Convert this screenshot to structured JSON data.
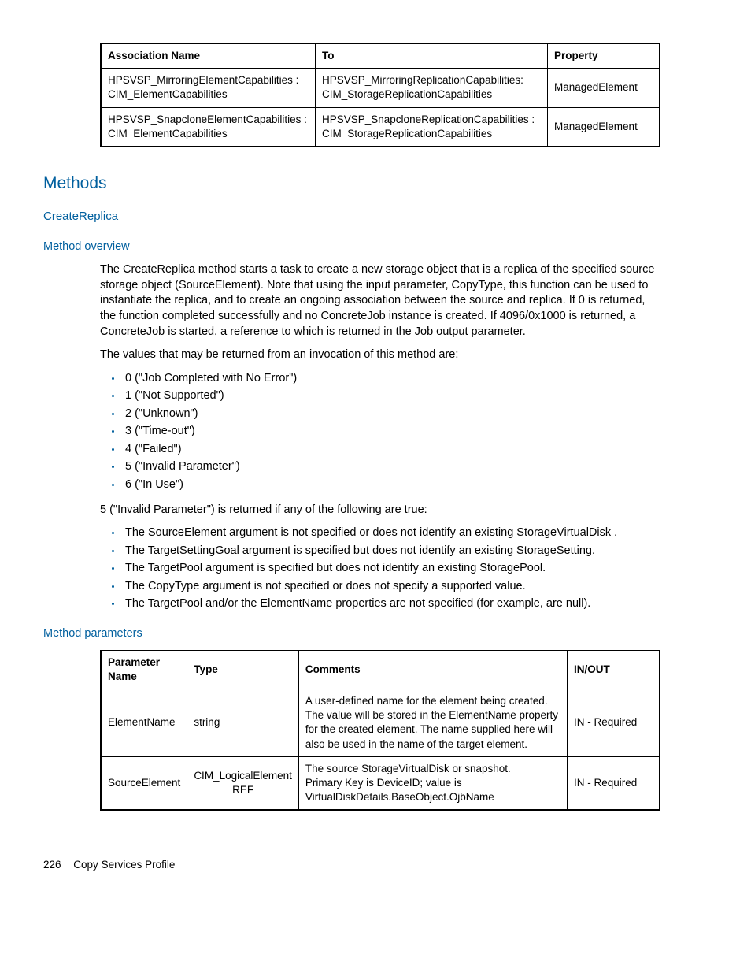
{
  "assocTable": {
    "headers": [
      "Association Name",
      "To",
      "Property"
    ],
    "rows": [
      [
        "HPSVSP_MirroringElementCapabilities : CIM_ElementCapabilities",
        "HPSVSP_MirroringReplicationCapabilities: CIM_StorageReplicationCapabilities",
        "ManagedElement"
      ],
      [
        "HPSVSP_SnapcloneElementCapabilities : CIM_ElementCapabilities",
        "HPSVSP_SnapcloneReplicationCapabilities : CIM_StorageReplicationCapabilities",
        "ManagedElement"
      ]
    ]
  },
  "methodsHeading": "Methods",
  "createReplicaHeading": "CreateReplica",
  "methodOverviewHeading": "Method overview",
  "overviewP1": "The CreateReplica method starts a task to create a new storage object that is a replica of the specified source storage object (SourceElement). Note that using the input parameter, CopyType, this function can be used to instantiate the replica, and to create an ongoing association between the source and replica. If 0 is returned, the function completed successfully and no ConcreteJob instance is created. If 4096/0x1000 is returned, a ConcreteJob is started, a reference to which is returned in the Job output parameter.",
  "overviewP2": "The values that may be returned from an invocation of this method are:",
  "returnValues": [
    "0 (\"Job Completed with No Error\")",
    "1 (\"Not Supported\")",
    "2 (\"Unknown\")",
    "3 (\"Time-out\")",
    "4 (\"Failed\")",
    "5 (\"Invalid Parameter\")",
    "6 (\"In Use\")"
  ],
  "overviewP3": "5 (\"Invalid Parameter\") is returned if any of the following are true:",
  "invalidConditions": [
    "The SourceElement argument is not specified or does not identify an existing StorageVirtualDisk .",
    "The TargetSettingGoal argument is specified but does not identify an existing StorageSetting.",
    "The TargetPool argument is specified but does not identify an existing StoragePool.",
    "The CopyType argument is not specified or does not specify a supported value.",
    "The TargetPool and/or the ElementName properties are not specified (for example, are null)."
  ],
  "methodParamsHeading": "Method parameters",
  "paramsTable": {
    "headers": [
      "Parameter Name",
      "Type",
      "Comments",
      "IN/OUT"
    ],
    "rows": [
      [
        "ElementName",
        "string",
        "A user-defined name for the element being created. The value will be stored in the ElementName property for the created element. The name supplied here will also be used in the name of the target element.",
        "IN - Required"
      ],
      [
        "SourceElement",
        "CIM_LogicalElement REF",
        "The source StorageVirtualDisk or snapshot.\nPrimary Key is DeviceID; value is VirtualDiskDetails.BaseObject.OjbName",
        "IN - Required"
      ]
    ]
  },
  "footer": {
    "page": "226",
    "title": "Copy Services Profile"
  }
}
